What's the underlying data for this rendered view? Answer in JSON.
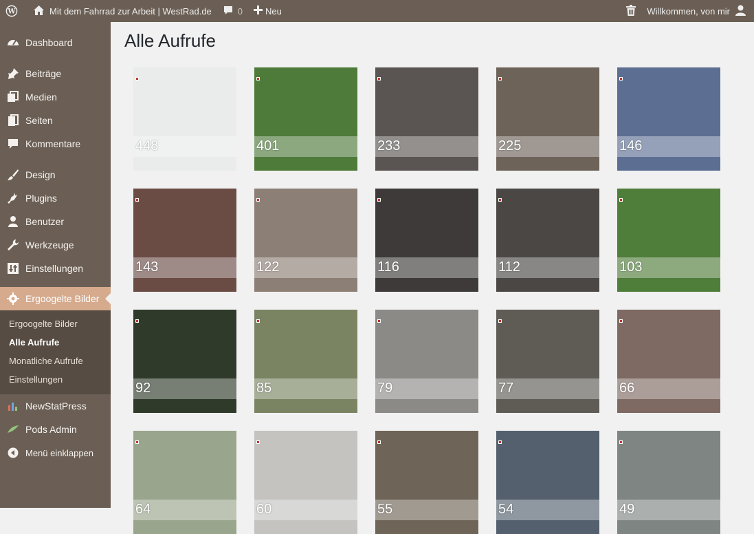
{
  "adminbar": {
    "site_title": "Mit dem Fahrrad zur Arbeit | WestRad.de",
    "comments_count": "0",
    "new_label": "Neu",
    "greeting": "Willkommen, von mir"
  },
  "sidebar": {
    "items": [
      {
        "label": "Dashboard",
        "icon": "dashboard-icon"
      },
      {
        "label": "Beiträge",
        "icon": "pin-icon"
      },
      {
        "label": "Medien",
        "icon": "media-icon"
      },
      {
        "label": "Seiten",
        "icon": "pages-icon"
      },
      {
        "label": "Kommentare",
        "icon": "comment-icon"
      },
      {
        "label": "Design",
        "icon": "brush-icon"
      },
      {
        "label": "Plugins",
        "icon": "plugin-icon"
      },
      {
        "label": "Benutzer",
        "icon": "user-icon"
      },
      {
        "label": "Werkzeuge",
        "icon": "wrench-icon"
      },
      {
        "label": "Einstellungen",
        "icon": "settings-icon"
      },
      {
        "label": "Ergoogelte Bilder",
        "icon": "gear-icon"
      },
      {
        "label": "NewStatPress",
        "icon": "chart-icon"
      },
      {
        "label": "Pods Admin",
        "icon": "pods-icon"
      },
      {
        "label": "Menü einklappen",
        "icon": "collapse-icon"
      }
    ],
    "submenu": [
      {
        "label": "Ergoogelte Bilder"
      },
      {
        "label": "Alle Aufrufe"
      },
      {
        "label": "Monatliche Aufrufe"
      },
      {
        "label": "Einstellungen"
      }
    ]
  },
  "main": {
    "title": "Alle Aufrufe",
    "tiles": [
      {
        "count": "448",
        "bg": "#e9ecea"
      },
      {
        "count": "401",
        "bg": "#4e7a3a"
      },
      {
        "count": "233",
        "bg": "#5a5552"
      },
      {
        "count": "225",
        "bg": "#6d6359"
      },
      {
        "count": "146",
        "bg": "#5c6f93"
      },
      {
        "count": "143",
        "bg": "#6b4c45"
      },
      {
        "count": "122",
        "bg": "#8c7f76"
      },
      {
        "count": "116",
        "bg": "#3e3a3a"
      },
      {
        "count": "112",
        "bg": "#4a4745"
      },
      {
        "count": "103",
        "bg": "#4f7d3a"
      },
      {
        "count": "92",
        "bg": "#2f3a2a"
      },
      {
        "count": "85",
        "bg": "#7a8463"
      },
      {
        "count": "79",
        "bg": "#8c8a87"
      },
      {
        "count": "77",
        "bg": "#5f5b55"
      },
      {
        "count": "66",
        "bg": "#7e6a63"
      },
      {
        "count": "64",
        "bg": "#9aa58d"
      },
      {
        "count": "60",
        "bg": "#c4c3c0"
      },
      {
        "count": "55",
        "bg": "#6e6457"
      },
      {
        "count": "54",
        "bg": "#54606e"
      },
      {
        "count": "49",
        "bg": "#7f8583"
      }
    ]
  }
}
